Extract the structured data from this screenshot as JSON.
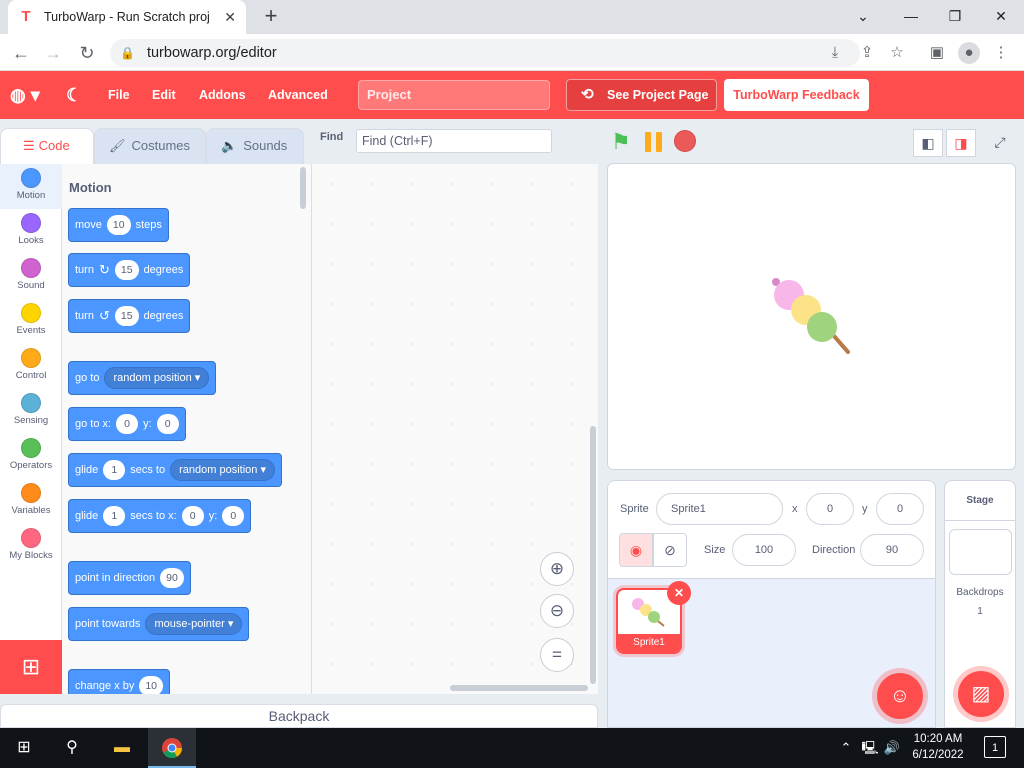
{
  "browser": {
    "tab_title": "TurboWarp - Run Scratch project",
    "tab_favicon": "T",
    "url": "turbowarp.org/editor"
  },
  "menubar": {
    "file": "File",
    "edit": "Edit",
    "addons": "Addons",
    "advanced": "Advanced",
    "project_title": "Project",
    "see_project_page": "See Project Page",
    "feedback": "TurboWarp Feedback"
  },
  "editor_tabs": {
    "code": "Code",
    "costumes": "Costumes",
    "sounds": "Sounds"
  },
  "find": {
    "label": "Find",
    "placeholder": "Find (Ctrl+F)"
  },
  "categories": [
    {
      "label": "Motion",
      "color": "#4c97ff"
    },
    {
      "label": "Looks",
      "color": "#9966ff"
    },
    {
      "label": "Sound",
      "color": "#cf63cf"
    },
    {
      "label": "Events",
      "color": "#ffd500"
    },
    {
      "label": "Control",
      "color": "#ffab19"
    },
    {
      "label": "Sensing",
      "color": "#5cb1d6"
    },
    {
      "label": "Operators",
      "color": "#59c059"
    },
    {
      "label": "Variables",
      "color": "#ff8c1a"
    },
    {
      "label": "My Blocks",
      "color": "#ff6680"
    }
  ],
  "palette": {
    "title": "Motion",
    "move": {
      "a": "move",
      "v": "10",
      "b": "steps"
    },
    "turn_right": {
      "a": "turn",
      "v": "15",
      "b": "degrees"
    },
    "turn_left": {
      "a": "turn",
      "v": "15",
      "b": "degrees"
    },
    "goto": {
      "a": "go to",
      "dd": "random position"
    },
    "goto_xy": {
      "a": "go to x:",
      "x": "0",
      "b": "y:",
      "y": "0"
    },
    "glide_to": {
      "a": "glide",
      "v": "1",
      "b": "secs to",
      "dd": "random position"
    },
    "glide_xy": {
      "a": "glide",
      "v": "1",
      "b": "secs to x:",
      "x": "0",
      "c": "y:",
      "y": "0"
    },
    "point_dir": {
      "a": "point in direction",
      "v": "90"
    },
    "point_towards": {
      "a": "point towards",
      "dd": "mouse-pointer"
    },
    "change_x": {
      "a": "change x by",
      "v": "10"
    }
  },
  "backpack": "Backpack",
  "sprite_info": {
    "sprite_label": "Sprite",
    "sprite_name": "Sprite1",
    "x_label": "x",
    "x": "0",
    "y_label": "y",
    "y": "0",
    "show_label": "Show",
    "size_label": "Size",
    "size": "100",
    "direction_label": "Direction",
    "direction": "90"
  },
  "sprites": [
    {
      "name": "Sprite1"
    }
  ],
  "stage_pane": {
    "title": "Stage",
    "backdrops_label": "Backdrops",
    "backdrops_count": "1"
  },
  "taskbar": {
    "time": "10:20 AM",
    "date": "6/12/2022",
    "notifications": "1"
  },
  "colors": {
    "accent": "#ff4c4c",
    "motion": "#4c97ff"
  }
}
